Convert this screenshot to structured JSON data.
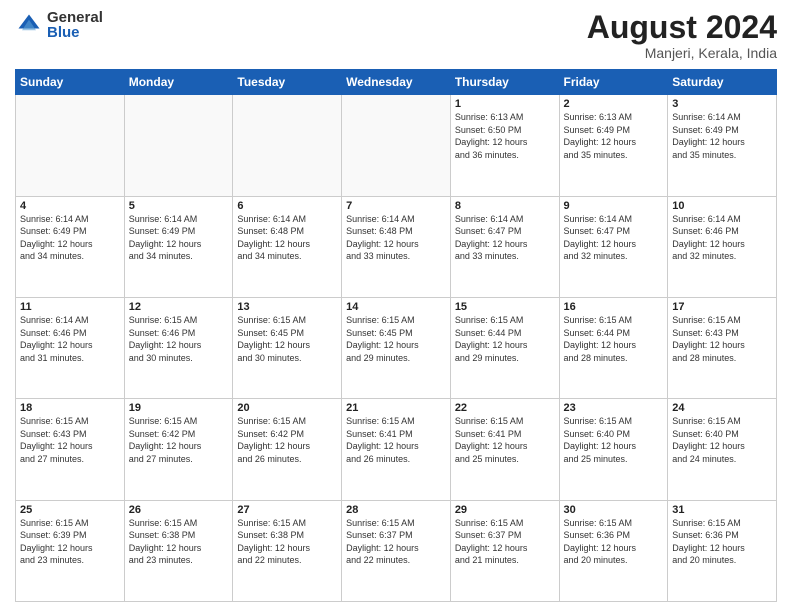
{
  "header": {
    "logo_general": "General",
    "logo_blue": "Blue",
    "month_year": "August 2024",
    "location": "Manjeri, Kerala, India"
  },
  "weekdays": [
    "Sunday",
    "Monday",
    "Tuesday",
    "Wednesday",
    "Thursday",
    "Friday",
    "Saturday"
  ],
  "weeks": [
    [
      {
        "day": "",
        "info": ""
      },
      {
        "day": "",
        "info": ""
      },
      {
        "day": "",
        "info": ""
      },
      {
        "day": "",
        "info": ""
      },
      {
        "day": "1",
        "info": "Sunrise: 6:13 AM\nSunset: 6:50 PM\nDaylight: 12 hours\nand 36 minutes."
      },
      {
        "day": "2",
        "info": "Sunrise: 6:13 AM\nSunset: 6:49 PM\nDaylight: 12 hours\nand 35 minutes."
      },
      {
        "day": "3",
        "info": "Sunrise: 6:14 AM\nSunset: 6:49 PM\nDaylight: 12 hours\nand 35 minutes."
      }
    ],
    [
      {
        "day": "4",
        "info": "Sunrise: 6:14 AM\nSunset: 6:49 PM\nDaylight: 12 hours\nand 34 minutes."
      },
      {
        "day": "5",
        "info": "Sunrise: 6:14 AM\nSunset: 6:49 PM\nDaylight: 12 hours\nand 34 minutes."
      },
      {
        "day": "6",
        "info": "Sunrise: 6:14 AM\nSunset: 6:48 PM\nDaylight: 12 hours\nand 34 minutes."
      },
      {
        "day": "7",
        "info": "Sunrise: 6:14 AM\nSunset: 6:48 PM\nDaylight: 12 hours\nand 33 minutes."
      },
      {
        "day": "8",
        "info": "Sunrise: 6:14 AM\nSunset: 6:47 PM\nDaylight: 12 hours\nand 33 minutes."
      },
      {
        "day": "9",
        "info": "Sunrise: 6:14 AM\nSunset: 6:47 PM\nDaylight: 12 hours\nand 32 minutes."
      },
      {
        "day": "10",
        "info": "Sunrise: 6:14 AM\nSunset: 6:46 PM\nDaylight: 12 hours\nand 32 minutes."
      }
    ],
    [
      {
        "day": "11",
        "info": "Sunrise: 6:14 AM\nSunset: 6:46 PM\nDaylight: 12 hours\nand 31 minutes."
      },
      {
        "day": "12",
        "info": "Sunrise: 6:15 AM\nSunset: 6:46 PM\nDaylight: 12 hours\nand 30 minutes."
      },
      {
        "day": "13",
        "info": "Sunrise: 6:15 AM\nSunset: 6:45 PM\nDaylight: 12 hours\nand 30 minutes."
      },
      {
        "day": "14",
        "info": "Sunrise: 6:15 AM\nSunset: 6:45 PM\nDaylight: 12 hours\nand 29 minutes."
      },
      {
        "day": "15",
        "info": "Sunrise: 6:15 AM\nSunset: 6:44 PM\nDaylight: 12 hours\nand 29 minutes."
      },
      {
        "day": "16",
        "info": "Sunrise: 6:15 AM\nSunset: 6:44 PM\nDaylight: 12 hours\nand 28 minutes."
      },
      {
        "day": "17",
        "info": "Sunrise: 6:15 AM\nSunset: 6:43 PM\nDaylight: 12 hours\nand 28 minutes."
      }
    ],
    [
      {
        "day": "18",
        "info": "Sunrise: 6:15 AM\nSunset: 6:43 PM\nDaylight: 12 hours\nand 27 minutes."
      },
      {
        "day": "19",
        "info": "Sunrise: 6:15 AM\nSunset: 6:42 PM\nDaylight: 12 hours\nand 27 minutes."
      },
      {
        "day": "20",
        "info": "Sunrise: 6:15 AM\nSunset: 6:42 PM\nDaylight: 12 hours\nand 26 minutes."
      },
      {
        "day": "21",
        "info": "Sunrise: 6:15 AM\nSunset: 6:41 PM\nDaylight: 12 hours\nand 26 minutes."
      },
      {
        "day": "22",
        "info": "Sunrise: 6:15 AM\nSunset: 6:41 PM\nDaylight: 12 hours\nand 25 minutes."
      },
      {
        "day": "23",
        "info": "Sunrise: 6:15 AM\nSunset: 6:40 PM\nDaylight: 12 hours\nand 25 minutes."
      },
      {
        "day": "24",
        "info": "Sunrise: 6:15 AM\nSunset: 6:40 PM\nDaylight: 12 hours\nand 24 minutes."
      }
    ],
    [
      {
        "day": "25",
        "info": "Sunrise: 6:15 AM\nSunset: 6:39 PM\nDaylight: 12 hours\nand 23 minutes."
      },
      {
        "day": "26",
        "info": "Sunrise: 6:15 AM\nSunset: 6:38 PM\nDaylight: 12 hours\nand 23 minutes."
      },
      {
        "day": "27",
        "info": "Sunrise: 6:15 AM\nSunset: 6:38 PM\nDaylight: 12 hours\nand 22 minutes."
      },
      {
        "day": "28",
        "info": "Sunrise: 6:15 AM\nSunset: 6:37 PM\nDaylight: 12 hours\nand 22 minutes."
      },
      {
        "day": "29",
        "info": "Sunrise: 6:15 AM\nSunset: 6:37 PM\nDaylight: 12 hours\nand 21 minutes."
      },
      {
        "day": "30",
        "info": "Sunrise: 6:15 AM\nSunset: 6:36 PM\nDaylight: 12 hours\nand 20 minutes."
      },
      {
        "day": "31",
        "info": "Sunrise: 6:15 AM\nSunset: 6:36 PM\nDaylight: 12 hours\nand 20 minutes."
      }
    ]
  ]
}
